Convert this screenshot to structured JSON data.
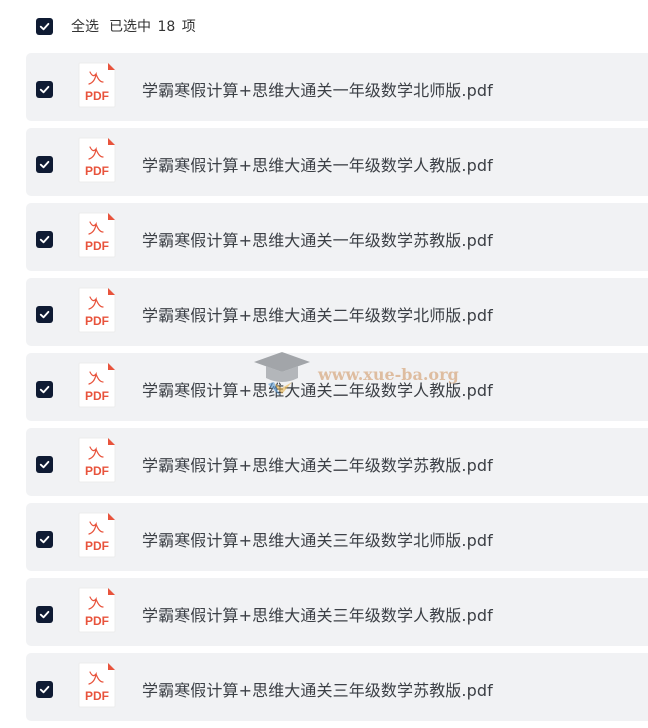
{
  "header": {
    "select_all_label": "全选",
    "selected_prefix": "已选中",
    "selected_count": "18",
    "selected_suffix": "项"
  },
  "file_icon_label": "PDF",
  "watermark": "www.xue-ba.org",
  "colors": {
    "checkbox": "#0f1b33",
    "row_bg": "#f1f2f4",
    "pdf_red": "#e8533c",
    "text": "#3b3f45"
  },
  "files": [
    {
      "name": "学霸寒假计算+思维大通关一年级数学北师版.pdf",
      "checked": true
    },
    {
      "name": "学霸寒假计算+思维大通关一年级数学人教版.pdf",
      "checked": true
    },
    {
      "name": "学霸寒假计算+思维大通关一年级数学苏教版.pdf",
      "checked": true
    },
    {
      "name": "学霸寒假计算+思维大通关二年级数学北师版.pdf",
      "checked": true
    },
    {
      "name": "学霸寒假计算+思维大通关二年级数学人教版.pdf",
      "checked": true
    },
    {
      "name": "学霸寒假计算+思维大通关二年级数学苏教版.pdf",
      "checked": true
    },
    {
      "name": "学霸寒假计算+思维大通关三年级数学北师版.pdf",
      "checked": true
    },
    {
      "name": "学霸寒假计算+思维大通关三年级数学人教版.pdf",
      "checked": true
    },
    {
      "name": "学霸寒假计算+思维大通关三年级数学苏教版.pdf",
      "checked": true
    }
  ]
}
